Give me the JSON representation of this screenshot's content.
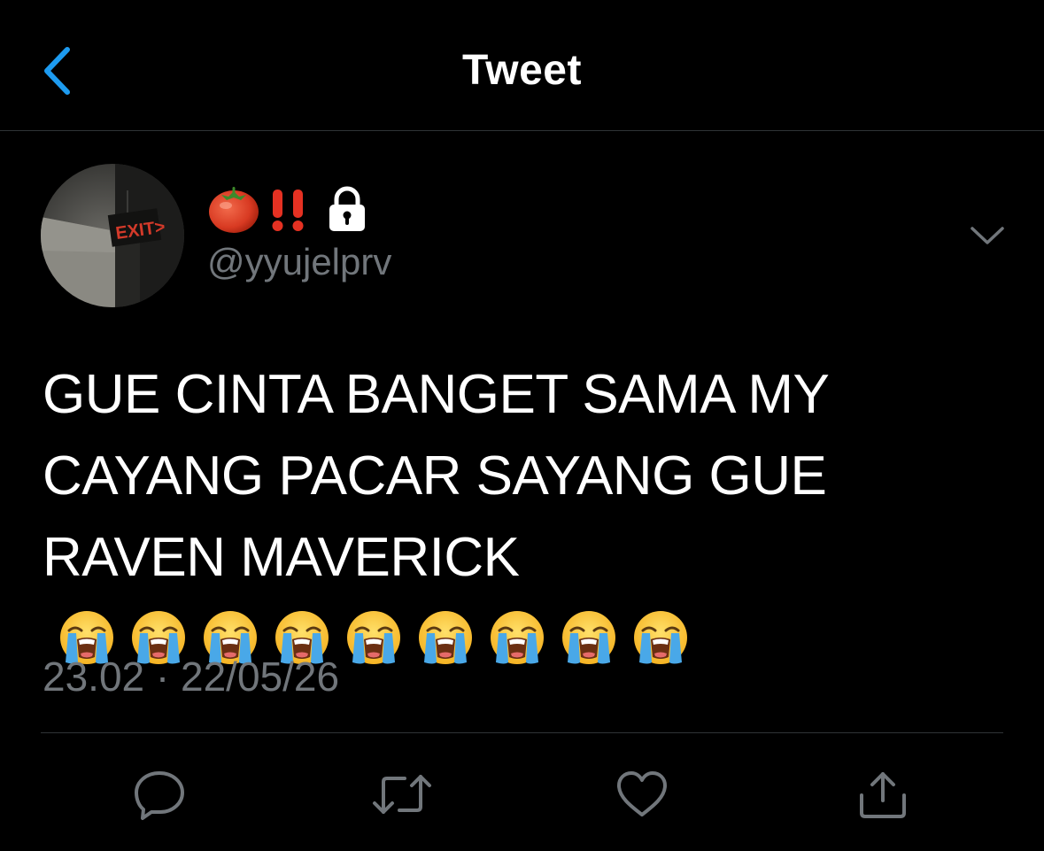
{
  "header": {
    "title": "Tweet",
    "back_icon": "chevron-left-icon"
  },
  "tweet": {
    "display_name_icons": [
      "tomato-emoji",
      "double-exclamation-emoji",
      "lock-icon"
    ],
    "handle": "@yyujelprv",
    "avatar_sign_text": "EXIT>",
    "text": "GUE CINTA BANGET SAMA MY CAYANG PACAR SAYANG GUE RAVEN MAVERICK",
    "emoji_count": 9,
    "emoji": "loudly-crying-face-emoji",
    "timestamp": "23.02 · 22/05/26"
  },
  "actions": [
    "reply-icon",
    "retweet-icon",
    "like-icon",
    "share-icon"
  ],
  "colors": {
    "background": "#000000",
    "accent": "#1d9bf0",
    "secondary_text": "#71767b",
    "divider": "#2f3336"
  }
}
